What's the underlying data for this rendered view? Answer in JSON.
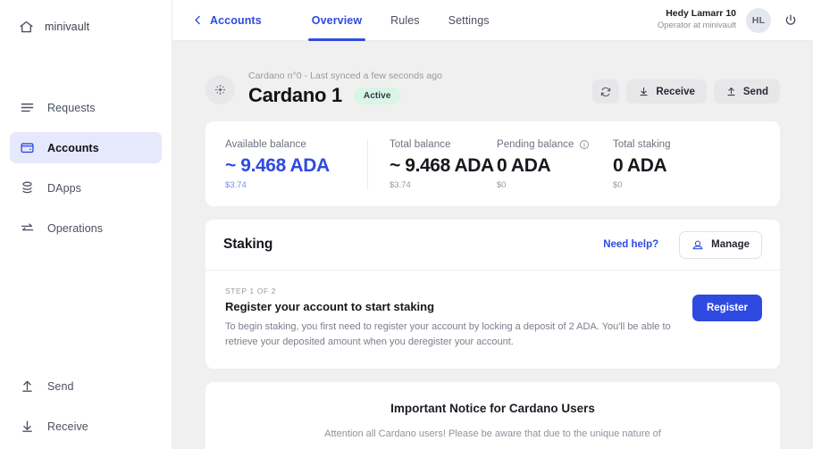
{
  "sidebar": {
    "brand": {
      "name": "minivault",
      "icon": "home-icon"
    },
    "items": [
      {
        "label": "Requests",
        "icon": "requests-icon",
        "active": false
      },
      {
        "label": "Accounts",
        "icon": "wallet-icon",
        "active": true
      },
      {
        "label": "DApps",
        "icon": "dapps-icon",
        "active": false
      },
      {
        "label": "Operations",
        "icon": "operations-icon",
        "active": false
      }
    ],
    "bottom_items": [
      {
        "label": "Send",
        "icon": "arrow-up-icon"
      },
      {
        "label": "Receive",
        "icon": "arrow-down-icon"
      }
    ]
  },
  "topbar": {
    "back_label": "Accounts",
    "back_icon": "chevron-left-icon",
    "tabs": [
      {
        "label": "Overview",
        "active": true
      },
      {
        "label": "Rules",
        "active": false
      },
      {
        "label": "Settings",
        "active": false
      }
    ],
    "user": {
      "name": "Hedy Lamarr 10",
      "role": "Operator at minivault",
      "initials": "HL",
      "power_icon": "power-icon"
    }
  },
  "account": {
    "subtitle": "Cardano n°0 - Last synced a few seconds ago",
    "title": "Cardano 1",
    "status_badge": "Active",
    "avatar_icon": "cardano-icon",
    "actions": [
      {
        "label": "",
        "icon": "refresh-icon",
        "name": "refresh-button"
      },
      {
        "label": "Receive",
        "icon": "arrow-down-icon",
        "name": "receive-button"
      },
      {
        "label": "Send",
        "icon": "arrow-up-icon",
        "name": "send-button"
      }
    ]
  },
  "balances": [
    {
      "label": "Available balance",
      "value": "~ 9.468 ADA",
      "fiat": "$3.74",
      "accent": true,
      "info": false
    },
    {
      "label": "Total balance",
      "value": "~ 9.468 ADA",
      "fiat": "$3.74",
      "accent": false,
      "info": false
    },
    {
      "label": "Pending balance",
      "value": "0 ADA",
      "fiat": "$0",
      "accent": false,
      "info": true
    },
    {
      "label": "Total staking",
      "value": "0 ADA",
      "fiat": "$0",
      "accent": false,
      "info": false
    }
  ],
  "staking": {
    "title": "Staking",
    "need_help": "Need help?",
    "manage_label": "Manage",
    "manage_icon": "certificate-icon",
    "step_kicker": "STEP 1 OF 2",
    "step_title": "Register your account to start staking",
    "step_desc": "To begin staking, you first need to register your account by locking a deposit of 2 ADA. You'll be able to retrieve your deposited amount when you deregister your account.",
    "register_label": "Register"
  },
  "notice": {
    "title": "Important Notice for Cardano Users",
    "body": "Attention all Cardano users! Please be aware that due to the unique nature of"
  },
  "colors": {
    "accent_blue": "#2f4ae0",
    "active_nav_bg": "#e6e8fb",
    "badge_green": "#d8f5e6",
    "page_bg": "#f0f0f0"
  }
}
